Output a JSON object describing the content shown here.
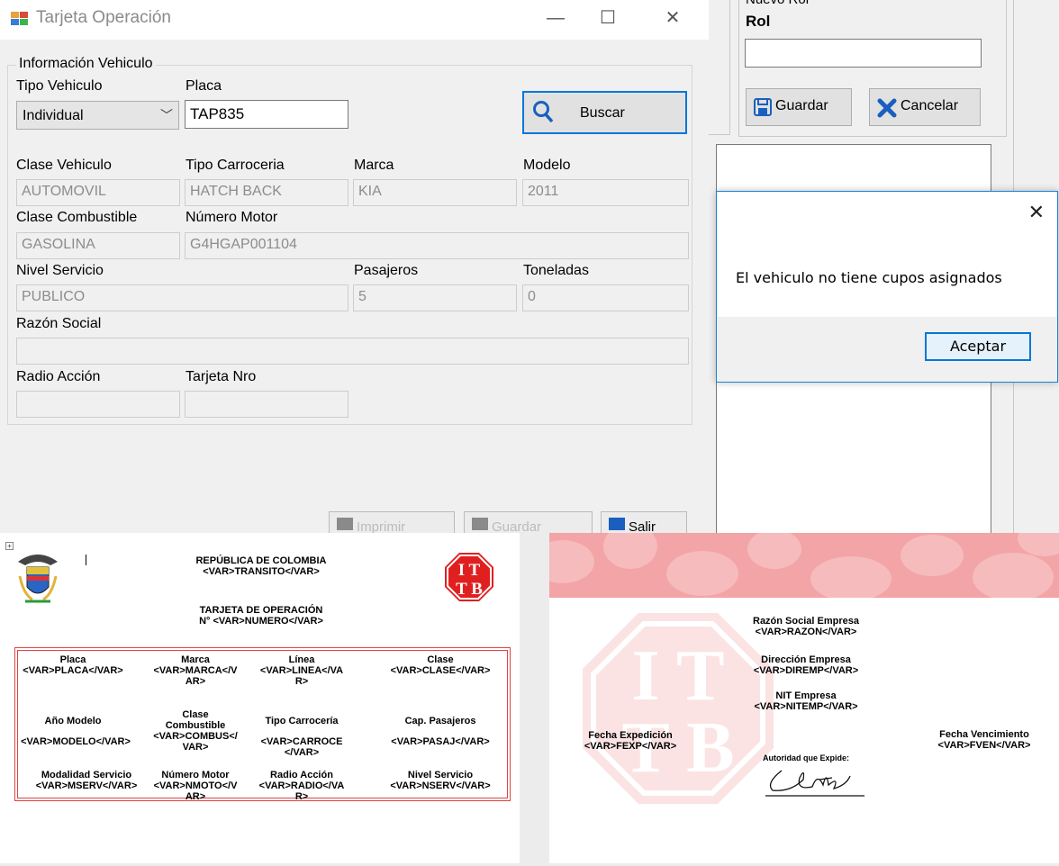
{
  "window": {
    "title": "Tarjeta Operación",
    "minimize": "—",
    "maximize": "☐",
    "close": "✕",
    "group_title": "Información Vehiculo",
    "tipo_vehiculo": {
      "label": "Tipo Vehiculo",
      "value": "Individual"
    },
    "placa": {
      "label": "Placa",
      "value": "TAP835"
    },
    "buscar": "Buscar",
    "clase_vehiculo": {
      "label": "Clase Vehiculo",
      "value": "AUTOMOVIL"
    },
    "tipo_carroceria": {
      "label": "Tipo Carroceria",
      "value": "HATCH BACK"
    },
    "marca": {
      "label": "Marca",
      "value": "KIA"
    },
    "modelo": {
      "label": "Modelo",
      "value": "2011"
    },
    "clase_combustible": {
      "label": "Clase Combustible",
      "value": "GASOLINA"
    },
    "numero_motor": {
      "label": "Número Motor",
      "value": "G4HGAP001104"
    },
    "nivel_servicio": {
      "label": "Nivel Servicio",
      "value": "PUBLICO"
    },
    "pasajeros": {
      "label": "Pasajeros",
      "value": "5"
    },
    "toneladas": {
      "label": "Toneladas",
      "value": "0"
    },
    "razon_social": {
      "label": "Razón Social",
      "value": ""
    },
    "radio_accion": {
      "label": "Radio Acción",
      "value": ""
    },
    "tarjeta_nro": {
      "label": "Tarjeta Nro",
      "value": ""
    },
    "btn_imprimir": "Imprimir",
    "btn_guardar": "Guardar",
    "btn_salir": "Salir"
  },
  "background_form": {
    "partial_label": "Nuevo Rol",
    "rol_label": "Rol",
    "guardar": "Guardar",
    "cancelar": "Cancelar"
  },
  "message_box": {
    "close": "✕",
    "text": "El vehiculo no tiene cupos asignados",
    "ok": "Aceptar"
  },
  "report": {
    "expand": "+",
    "header_line1": "REPÚBLICA DE COLOMBIA",
    "header_line2": "<VAR>TRANSITO</VAR>",
    "title_line1": "TARJETA DE OPERACIÓN",
    "title_line2": "N° <VAR>NUMERO</VAR>",
    "logo_letters": "ITTB",
    "cells": [
      {
        "label": "Placa",
        "var": "<VAR>PLACA</VAR>"
      },
      {
        "label": "Marca",
        "var": "<VAR>MARCA</VAR>"
      },
      {
        "label": "Línea",
        "var": "<VAR>LINEA</VAR>"
      },
      {
        "label": "Clase",
        "var": "<VAR>CLASE</VAR>"
      },
      {
        "label": "Año Modelo",
        "var": "<VAR>MODELO</VAR>"
      },
      {
        "label": "Clase Combustible",
        "var": "<VAR>COMBUS</VAR>"
      },
      {
        "label": "Tipo Carrocería",
        "var": "<VAR>CARROCE</VAR>"
      },
      {
        "label": "Cap. Pasajeros",
        "var": "<VAR>PASAJ</VAR>"
      },
      {
        "label": "Modalidad Servicio",
        "var": "<VAR>MSERV</VAR>"
      },
      {
        "label": "Número Motor",
        "var": "<VAR>NMOTO</VAR>"
      },
      {
        "label": "Radio Acción",
        "var": "<VAR>RADIO</VAR>"
      },
      {
        "label": "Nivel Servicio",
        "var": "<VAR>NSERV</VAR>"
      }
    ],
    "razon_label": "Razón Social Empresa",
    "razon_var": "<VAR>RAZON</VAR>",
    "direccion_label": "Dirección Empresa",
    "direccion_var": "<VAR>DIREMP</VAR>",
    "nit_label": "NIT Empresa",
    "nit_var": "<VAR>NITEMP</VAR>",
    "fexp_label": "Fecha Expedición",
    "fexp_var": "<VAR>FEXP</VAR>",
    "fven_label": "Fecha Vencimiento",
    "fven_var": "<VAR>FVEN</VAR>",
    "autoridad": "Autoridad que Expide:"
  },
  "colors": {
    "accent": "#0078d7",
    "report_border": "#dd4444",
    "banner": "#f3a4a6"
  }
}
